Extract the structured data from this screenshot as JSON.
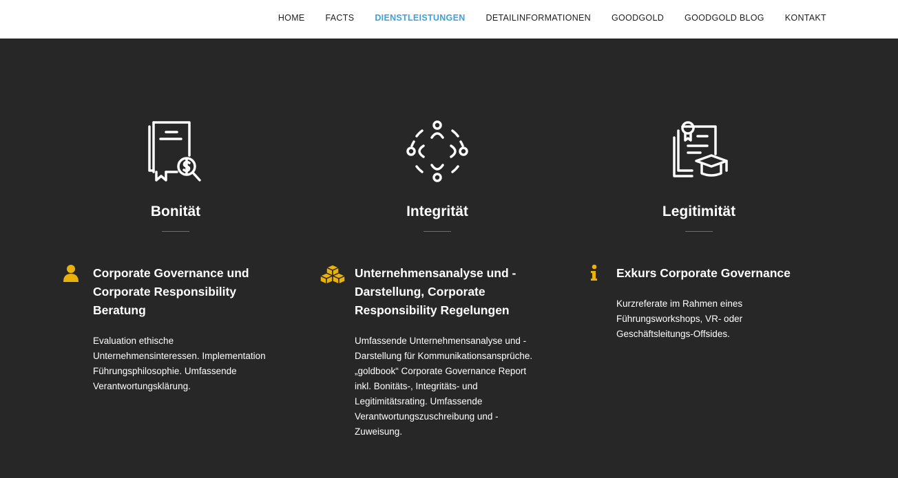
{
  "nav": {
    "items": [
      {
        "label": "HOME"
      },
      {
        "label": "FACTS"
      },
      {
        "label": "DIENSTLEISTUNGEN",
        "active": true
      },
      {
        "label": "DETAILINFORMATIONEN"
      },
      {
        "label": "GOODGOLD"
      },
      {
        "label": "GOODGOLD BLOG"
      },
      {
        "label": "KONTAKT"
      }
    ]
  },
  "colors": {
    "background": "#272727",
    "nav_active": "#3aa2dc",
    "accent": "#e8b10c",
    "text": "#ffffff"
  },
  "pillars": [
    {
      "title": "Bonität",
      "icon": "document-dollar-search-icon"
    },
    {
      "title": "Integrität",
      "icon": "people-circle-icon"
    },
    {
      "title": "Legitimität",
      "icon": "certificate-graduation-cap-icon"
    }
  ],
  "services": [
    {
      "icon": "user-icon",
      "title": "Corporate Governance und Corporate Responsibility Beratung",
      "text": "Evaluation ethische Unternehmensinteressen. Implementation Führungsphilosophie. Umfassende Verantwortungsklärung."
    },
    {
      "icon": "cubes-icon",
      "title": "Unternehmensanalyse und -Darstellung, Corporate Responsibility Regelungen",
      "text": "Umfassende Unternehmensanalyse und -Darstellung für Kommunikationsansprüche. „goldbook“ Corporate Governance Report inkl. Bonitäts-, Integritäts- und Legitimitätsrating. Umfassende Verantwortungszuschreibung und -Zuweisung."
    },
    {
      "icon": "info-icon",
      "title": "Exkurs Corporate Governance",
      "text": "Kurzreferate im Rahmen eines Führungsworkshops, VR- oder Geschäftsleitungs-Offsides."
    }
  ]
}
